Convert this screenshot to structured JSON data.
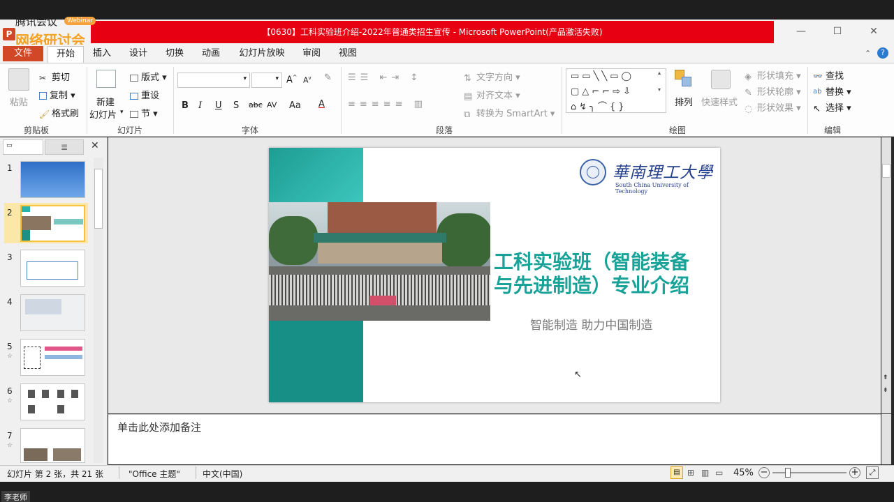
{
  "meeting": {
    "app_name": "腾讯会议",
    "webinar_badge": "Webinar",
    "seminar_label": "网络研讨会"
  },
  "window": {
    "title": "【0630】工科实验班介绍-2022年普通类招生宣传 - Microsoft PowerPoint(产品激活失败)",
    "minimize_glyph": "—",
    "maximize_glyph": "☐",
    "close_glyph": "✕"
  },
  "tabs": [
    "文件",
    "开始",
    "插入",
    "设计",
    "切换",
    "动画",
    "幻灯片放映",
    "审阅",
    "视图"
  ],
  "ribbon": {
    "clipboard": {
      "paste": "粘贴",
      "cut": "剪切",
      "copy": "复制",
      "format_painter": "格式刷",
      "label": "剪贴板"
    },
    "slides": {
      "new_slide_line1": "新建",
      "new_slide_line2": "幻灯片",
      "layout": "版式",
      "reset": "重设",
      "section": "节",
      "label": "幻灯片"
    },
    "font": {
      "label": "字体",
      "bold": "B",
      "italic": "I",
      "underline": "U",
      "shadow": "S",
      "strike": "abc",
      "spacing": "AV",
      "case": "Aa",
      "color": "A"
    },
    "paragraph": {
      "text_direction": "文字方向",
      "align_text": "对齐文本",
      "smartart": "转换为 SmartArt",
      "label": "段落"
    },
    "drawing": {
      "arrange": "排列",
      "quick_styles": "快速样式",
      "shape_fill": "形状填充",
      "shape_outline": "形状轮廓",
      "shape_effects": "形状效果",
      "label": "绘图"
    },
    "editing": {
      "find": "查找",
      "replace": "替换",
      "select": "选择",
      "label": "编辑"
    }
  },
  "thumbnails": [
    "1",
    "2",
    "3",
    "4",
    "5",
    "6",
    "7"
  ],
  "slide": {
    "university_cn": "華南理工大學",
    "university_en": "South China University of Technology",
    "title_line1": "工科实验班（智能装备",
    "title_line2": "与先进制造）专业介绍",
    "subtitle": "智能制造 助力中国制造"
  },
  "notes_placeholder": "单击此处添加备注",
  "status": {
    "slide_info": "幻灯片 第 2 张，共 21 张",
    "theme": "\"Office 主题\"",
    "language": "中文(中国)",
    "zoom": "45%"
  },
  "participant": "李老师",
  "colors": {
    "accent_red": "#e60012",
    "file_tab": "#d24726",
    "teal": "#1ea59a",
    "title_teal": "#19a398"
  }
}
